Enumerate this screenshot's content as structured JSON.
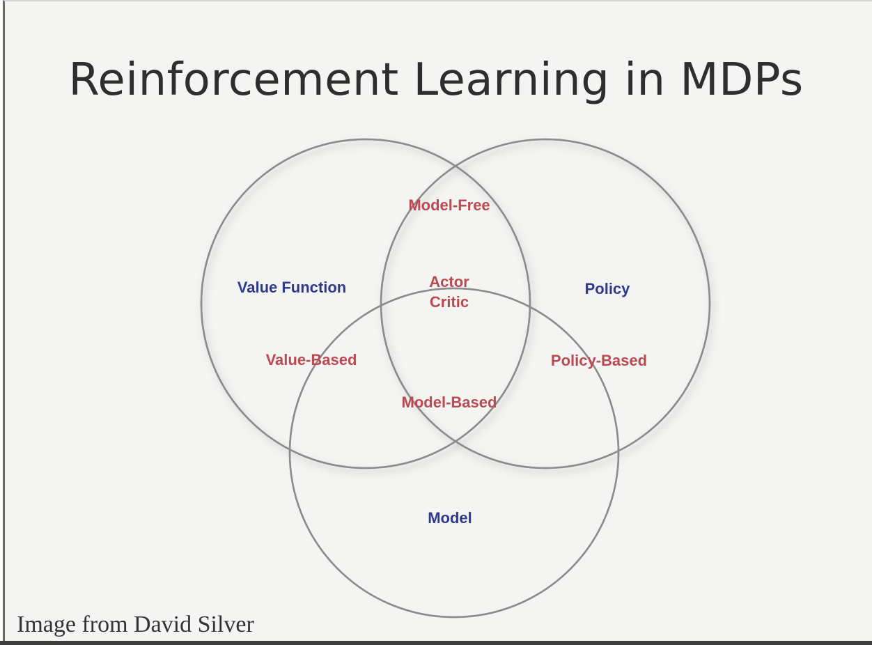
{
  "slide": {
    "title": "Reinforcement Learning in MDPs",
    "credit": "Image from David Silver"
  },
  "venn": {
    "sets": {
      "value_function": "Value Function",
      "policy": "Policy",
      "model": "Model"
    },
    "regions": {
      "model_free": "Model-Free",
      "actor": "Actor",
      "critic": "Critic",
      "value_based": "Value-Based",
      "policy_based": "Policy-Based",
      "model_based": "Model-Based"
    },
    "colors": {
      "set_label": "#2e3a8c",
      "region_label": "#b94a52",
      "circle_stroke": "#8c8c8c"
    }
  }
}
